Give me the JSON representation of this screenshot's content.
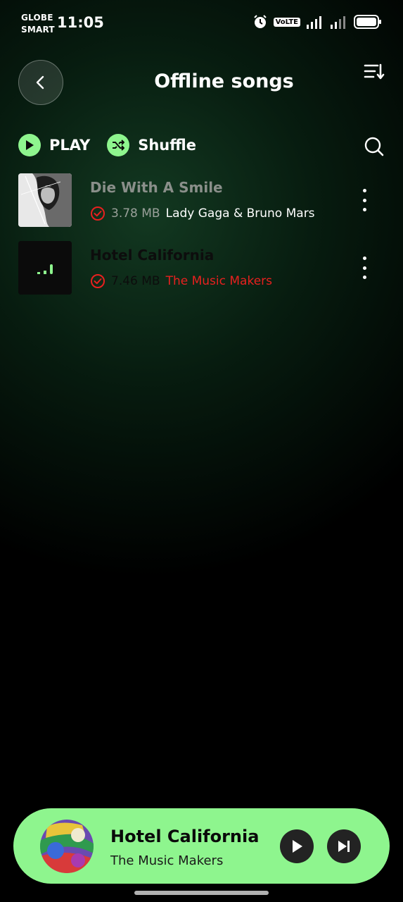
{
  "status": {
    "carrier_line1": "GLOBE",
    "carrier_line2": "SMART",
    "time": "11:05",
    "volte": "VoLTE",
    "icons": [
      "alarm-icon",
      "volte-icon",
      "signal-icon",
      "signal-icon",
      "battery-icon"
    ]
  },
  "header": {
    "title": "Offline songs",
    "back_icon": "chevron-left-icon",
    "sort_icon": "sort-icon"
  },
  "actions": {
    "play_label": "PLAY",
    "shuffle_label": "Shuffle",
    "search_icon": "search-icon"
  },
  "songs": [
    {
      "title": "Die With A Smile",
      "size": "3.78 MB",
      "artist": "Lady Gaga & Bruno Mars",
      "title_color": "#8a8f8a",
      "size_color": "#9aa09a",
      "artist_color": "#ffffff"
    },
    {
      "title": "Hotel California",
      "size": "7.46 MB",
      "artist": "The Music Makers",
      "title_color": "#0d0d0d",
      "size_color": "#0d0d0d",
      "artist_color": "#e8201f"
    }
  ],
  "now_playing": {
    "title": "Hotel California",
    "artist": "The Music Makers",
    "play_icon": "play-icon",
    "next_icon": "skip-next-icon"
  },
  "colors": {
    "accent": "#8ef58e",
    "downloaded_check": "#e8201f"
  }
}
